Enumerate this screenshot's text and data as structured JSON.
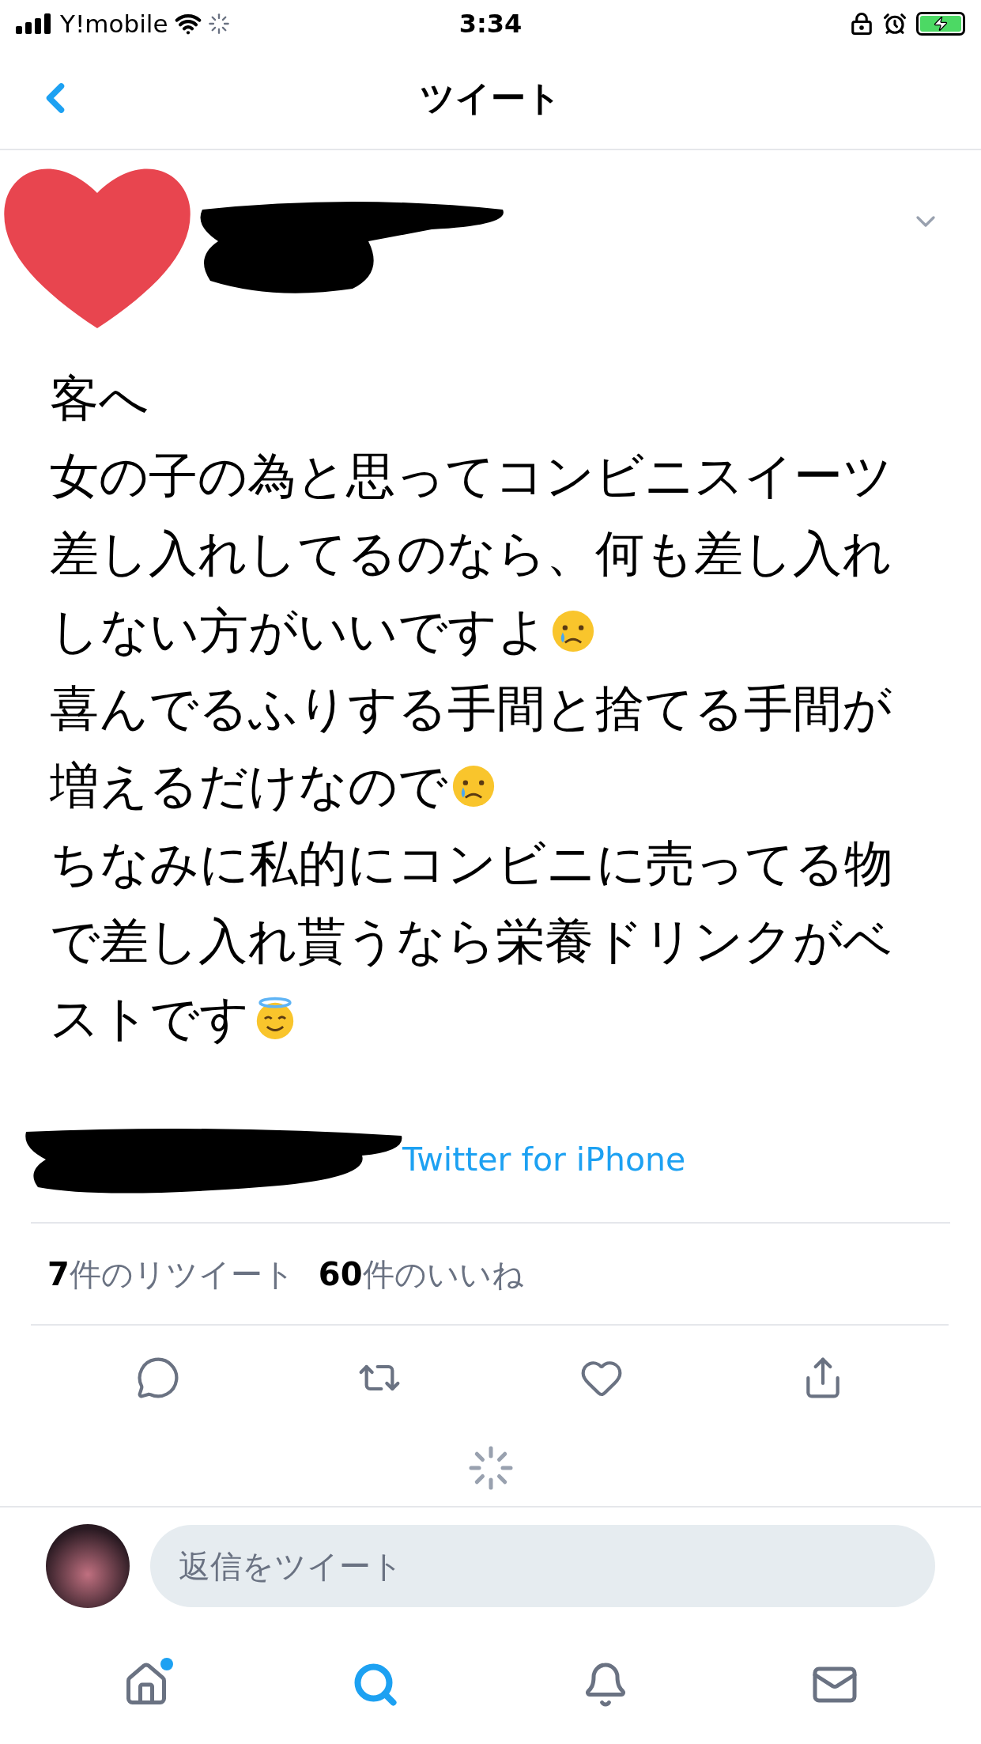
{
  "status_bar": {
    "carrier": "Y!mobile",
    "time": "3:34"
  },
  "header": {
    "title": "ツイート"
  },
  "tweet": {
    "lines": [
      {
        "text": "客へ",
        "kind": "plain"
      },
      {
        "text": "女の子の為と思ってコンビニスイーツ",
        "kind": "plain"
      },
      {
        "text": "差し入れしてるのなら、何も差し入れ",
        "kind": "plain"
      },
      {
        "text": "しない方がいいですよ",
        "kind": "crying"
      },
      {
        "text": "喜んでるふりする手間と捨てる手間が",
        "kind": "plain"
      },
      {
        "text": "増えるだけなので",
        "kind": "crying"
      },
      {
        "text": "ちなみに私的にコンビニに売ってる物",
        "kind": "plain"
      },
      {
        "text": "で差し入れ貰うなら栄養ドリンクがベ",
        "kind": "plain"
      },
      {
        "text": "ストです",
        "kind": "halo"
      }
    ],
    "source": "Twitter for iPhone",
    "stats": [
      {
        "count": "7",
        "label": "件のリツイート"
      },
      {
        "count": "60",
        "label": "件のいいね"
      }
    ]
  },
  "reply": {
    "placeholder": "返信をツイート"
  },
  "tab_bar": {
    "items": [
      {
        "kind": "home",
        "selected": false,
        "badge": true
      },
      {
        "kind": "search",
        "selected": true,
        "badge": false
      },
      {
        "kind": "notifications",
        "selected": false,
        "badge": false
      },
      {
        "kind": "messages",
        "selected": false,
        "badge": false
      }
    ]
  }
}
